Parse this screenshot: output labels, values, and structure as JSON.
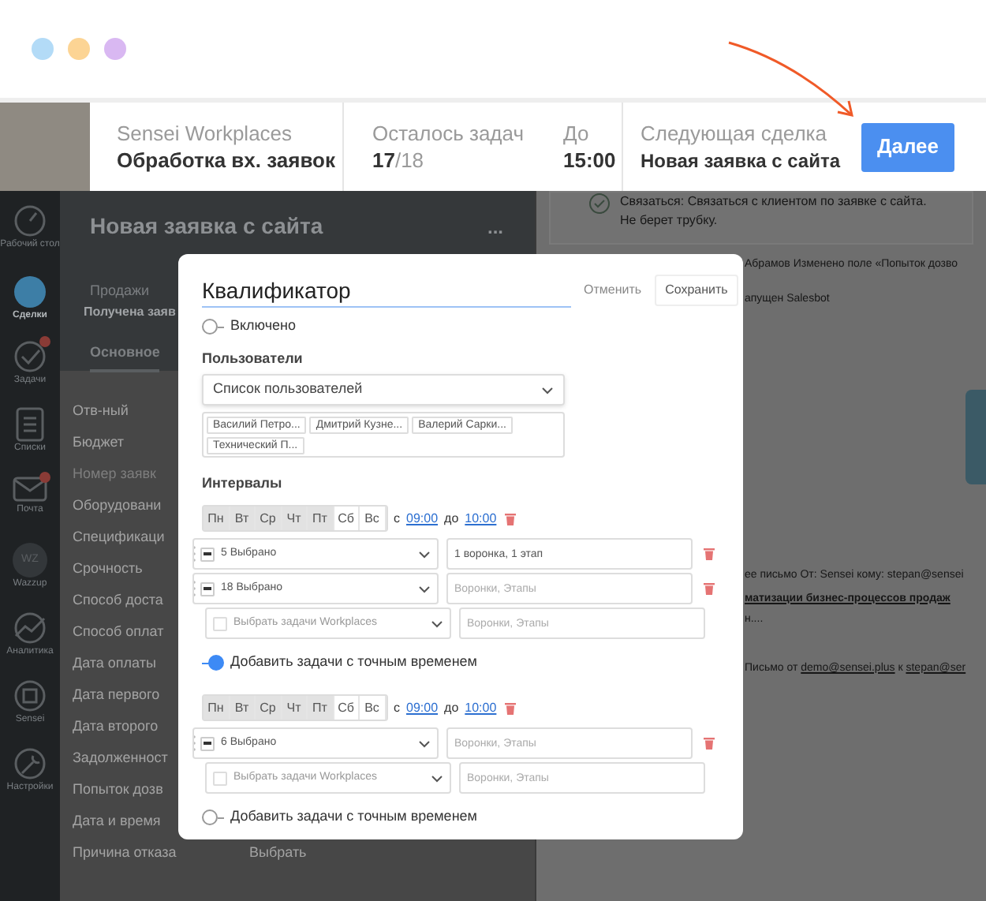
{
  "window_dots": [
    {
      "color": "#b3dbf7"
    },
    {
      "color": "#fcd494"
    },
    {
      "color": "#d9b8f2"
    }
  ],
  "header": {
    "app": "Sensei Workplaces",
    "process": "Обработка вх. заявок",
    "tasks_label": "Осталось задач",
    "tasks_done": "17",
    "tasks_total": "/18",
    "deadline_label": "До",
    "deadline": "15:00",
    "next_label": "Следующая сделка",
    "next_deal": "Новая заявка с сайта",
    "next_button": "Далее"
  },
  "sidebar": {
    "items": [
      {
        "label": "Рабочий стол",
        "selected": false,
        "badge": false
      },
      {
        "label": "Сделки",
        "selected": true,
        "badge": false
      },
      {
        "label": "Задачи",
        "selected": false,
        "badge": true
      },
      {
        "label": "Списки",
        "selected": false,
        "badge": false
      },
      {
        "label": "Почта",
        "selected": false,
        "badge": true
      },
      {
        "label": "Wazzup",
        "selected": false,
        "badge": false,
        "icon_text": "WZ"
      },
      {
        "label": "Аналитика",
        "selected": false,
        "badge": false
      },
      {
        "label": "Sensei",
        "selected": false,
        "badge": false
      },
      {
        "label": "Настройки",
        "selected": false,
        "badge": false
      }
    ]
  },
  "deal": {
    "title": "Новая заявка с сайта",
    "menu": "...",
    "pipeline": "Продажи",
    "stage": "Получена заяв",
    "tabs": [
      {
        "label": "Основное",
        "selected": true
      }
    ],
    "fields": [
      {
        "label": "Отв-ный",
        "disabled": false
      },
      {
        "label": "Бюджет",
        "disabled": false
      },
      {
        "label": "Номер заявк",
        "disabled": true
      },
      {
        "label": "Оборудовани",
        "disabled": false
      },
      {
        "label": "Спецификаци",
        "disabled": false
      },
      {
        "label": "Срочность",
        "disabled": false
      },
      {
        "label": "Способ доста",
        "disabled": false
      },
      {
        "label": "Способ оплат",
        "disabled": false
      },
      {
        "label": "Дата оплаты",
        "disabled": false
      },
      {
        "label": "Дата первого",
        "disabled": false
      },
      {
        "label": "Дата второго",
        "disabled": false
      },
      {
        "label": "Задолженност",
        "disabled": false
      },
      {
        "label": "Попыток дозв",
        "disabled": false
      },
      {
        "label": "Дата и время",
        "disabled": false
      },
      {
        "label": "Причина отказа",
        "disabled": false,
        "value": "Выбрать"
      }
    ]
  },
  "feed": {
    "task_line_1": "Связаться: Связаться с клиентом по заявке с сайта.",
    "task_line_2": "Не берет трубку.",
    "event_1": "Абрамов  Изменено поле «Попыток дозво",
    "event_2": "апущен Salesbot",
    "email_1": "ее письмо От: Sensei кому: stepan@sensei",
    "email_2": "матизации бизнес-процессов продаж",
    "email_3": "н....",
    "email_from_prefix": "Письмо от ",
    "email_from": "demo@sensei.plus",
    "email_to_prefix": " к ",
    "email_to": "stepan@ser"
  },
  "modal": {
    "title": "Квалификатор",
    "cancel": "Отменить",
    "save": "Сохранить",
    "enabled": {
      "label": "Включено",
      "on": false
    },
    "users_heading": "Пользователи",
    "users_select": "Список пользователей",
    "users": [
      "Василий Петро...",
      "Дмитрий Кузне...",
      "Валерий Сарки...",
      "Технический П..."
    ],
    "intervals_heading": "Интервалы",
    "intervals": [
      {
        "days": [
          {
            "label": "Пн",
            "selected": true
          },
          {
            "label": "Вт",
            "selected": true
          },
          {
            "label": "Ср",
            "selected": true
          },
          {
            "label": "Чт",
            "selected": true
          },
          {
            "label": "Пт",
            "selected": true
          },
          {
            "label": "Сб",
            "selected": false
          },
          {
            "label": "Вс",
            "selected": false
          }
        ],
        "from_label": "с",
        "from": "09:00",
        "to_label": "до",
        "to": "10:00",
        "rows": [
          {
            "kind": "selected",
            "indeterminate": true,
            "tasks": "5 Выбрано",
            "target": "1 воронка, 1 этап"
          },
          {
            "kind": "selected",
            "indeterminate": true,
            "tasks": "18 Выбрано",
            "target_placeholder": "Воронки, Этапы"
          },
          {
            "kind": "empty",
            "indeterminate": false,
            "tasks_placeholder": "Выбрать задачи Workplaces",
            "target_placeholder": "Воронки, Этапы"
          }
        ],
        "exact_time": {
          "label": "Добавить задачи с точным временем",
          "on": true
        }
      },
      {
        "days": [
          {
            "label": "Пн",
            "selected": true
          },
          {
            "label": "Вт",
            "selected": true
          },
          {
            "label": "Ср",
            "selected": true
          },
          {
            "label": "Чт",
            "selected": true
          },
          {
            "label": "Пт",
            "selected": true
          },
          {
            "label": "Сб",
            "selected": false
          },
          {
            "label": "Вс",
            "selected": false
          }
        ],
        "from_label": "с",
        "from": "09:00",
        "to_label": "до",
        "to": "10:00",
        "rows": [
          {
            "kind": "selected",
            "indeterminate": true,
            "tasks": "6 Выбрано",
            "target_placeholder": "Воронки, Этапы"
          },
          {
            "kind": "empty",
            "indeterminate": false,
            "tasks_placeholder": "Выбрать задачи Workplaces",
            "target_placeholder": "Воронки, Этапы"
          }
        ],
        "exact_time": {
          "label": "Добавить задачи с точным временем",
          "on": false
        }
      }
    ]
  }
}
